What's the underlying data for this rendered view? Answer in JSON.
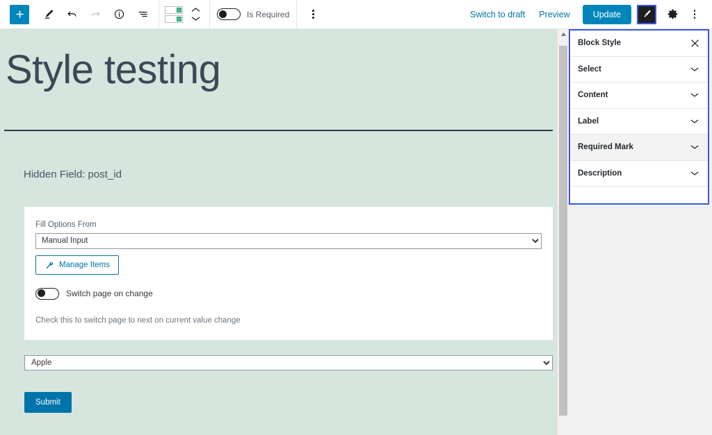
{
  "toolbar": {
    "add_block_label": "+",
    "icons": {
      "add": "plus-icon",
      "edit": "pencil-icon",
      "undo": "undo-icon",
      "redo": "redo-icon",
      "info": "info-icon",
      "list_view": "list-view-icon",
      "block_switcher": "block-switcher-icon",
      "move_up": "chevron-up-icon",
      "move_down": "chevron-down-icon",
      "options": "kebab-menu-icon",
      "style": "brush-icon",
      "settings": "gear-icon"
    },
    "is_required_label": "Is Required",
    "is_required_value": "off",
    "switch_to_draft_label": "Switch to draft",
    "preview_label": "Preview",
    "update_label": "Update",
    "accent_color": "#0085ba",
    "focus_color": "#3858e9"
  },
  "editor": {
    "post_title": "Style testing",
    "hidden_field_label": "Hidden Field: post_id",
    "background_color": "#d6e5de",
    "card": {
      "fill_options_label": "Fill Options From",
      "fill_options_value": "Manual Input",
      "fill_options_choices": [
        "Manual Input"
      ],
      "manage_items_label": "Manage Items",
      "manage_items_icon": "wrench-icon",
      "switch_page_label": "Switch page on change",
      "switch_page_value": "off",
      "help_text": "Check this to switch page to next on current value change"
    },
    "outer_select_value": "Apple",
    "outer_select_choices": [
      "Apple"
    ],
    "submit_label": "Submit",
    "submit_color": "#0073aa"
  },
  "scrollbar": {
    "up_arrow_icon": "scroll-up-arrow-icon"
  },
  "sidebar": {
    "panel_title": "Block Style",
    "close_icon": "close-icon",
    "border_color": "#3858e9",
    "sections": [
      {
        "label": "Select",
        "state": "collapsed",
        "hovered": false
      },
      {
        "label": "Content",
        "state": "collapsed",
        "hovered": false
      },
      {
        "label": "Label",
        "state": "collapsed",
        "hovered": false
      },
      {
        "label": "Required Mark",
        "state": "collapsed",
        "hovered": true
      },
      {
        "label": "Description",
        "state": "collapsed",
        "hovered": false
      }
    ]
  }
}
